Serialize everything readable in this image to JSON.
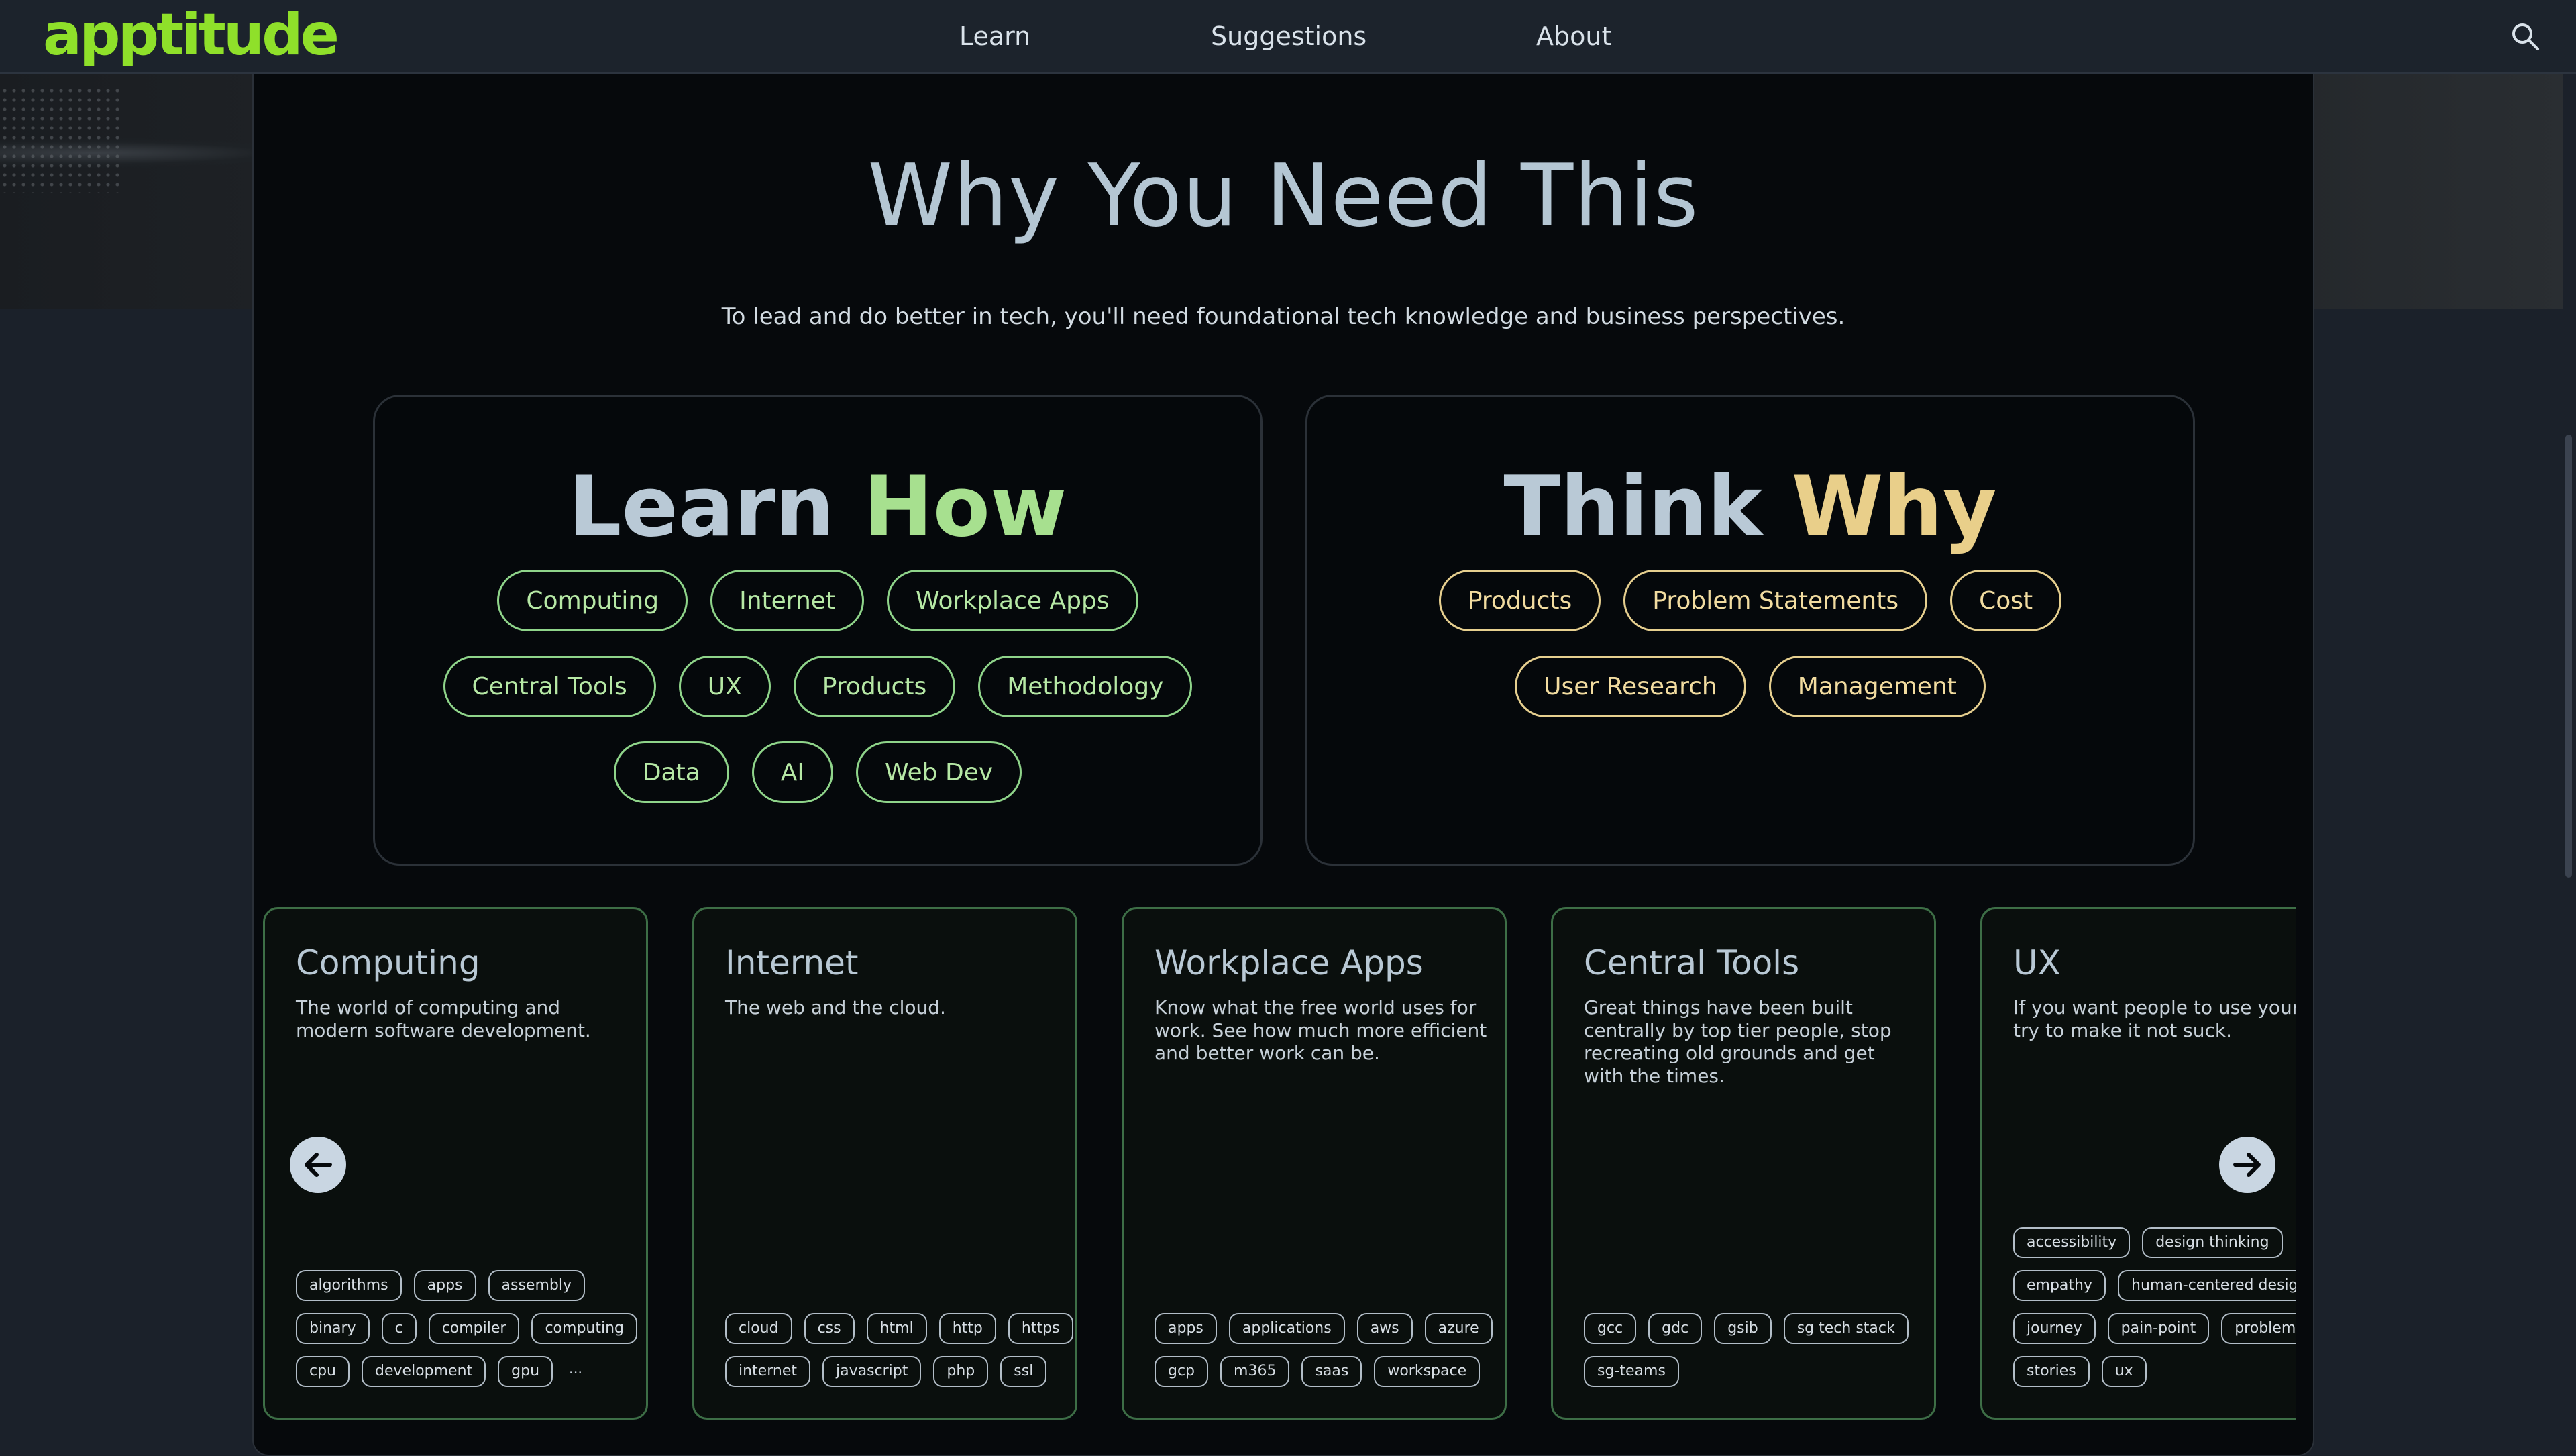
{
  "navbar": {
    "logo": "apptitude",
    "links": [
      "Learn",
      "Suggestions",
      "About"
    ],
    "search_icon": "search-icon"
  },
  "section": {
    "title": "Why You Need This",
    "subtitle": "To lead and do better in tech, you'll need foundational tech knowledge and business perspectives."
  },
  "learn_how": {
    "title_part1": "Learn",
    "title_part2": "How",
    "accent_color": "#a7e08f",
    "pills": [
      "Computing",
      "Internet",
      "Workplace Apps",
      "Central Tools",
      "UX",
      "Products",
      "Methodology",
      "Data",
      "AI",
      "Web Dev"
    ]
  },
  "think_why": {
    "title_part1": "Think",
    "title_part2": "Why",
    "accent_color": "#e9cf8a",
    "pills": [
      "Products",
      "Problem Statements",
      "Cost",
      "User Research",
      "Management"
    ]
  },
  "carousel": {
    "prev_icon": "arrow-left-icon",
    "next_icon": "arrow-right-icon",
    "cards": [
      {
        "title": "Computing",
        "description": "The world of computing and modern software development.",
        "tags": [
          "algorithms",
          "apps",
          "assembly",
          "binary",
          "c",
          "compiler",
          "computing",
          "cpu",
          "development",
          "gpu"
        ],
        "more": "..."
      },
      {
        "title": "Internet",
        "description": "The web and the cloud.",
        "tags": [
          "cloud",
          "css",
          "html",
          "http",
          "https",
          "internet",
          "javascript",
          "php",
          "ssl"
        ]
      },
      {
        "title": "Workplace Apps",
        "description": "Know what the free world uses for work. See how much more efficient and better work can be.",
        "tags": [
          "apps",
          "applications",
          "aws",
          "azure",
          "gcp",
          "m365",
          "saas",
          "workspace"
        ]
      },
      {
        "title": "Central Tools",
        "description": "Great things have been built centrally by top tier people, stop recreating old grounds and get with the times.",
        "tags": [
          "gcc",
          "gdc",
          "gsib",
          "sg tech stack",
          "sg-teams"
        ]
      },
      {
        "title": "UX",
        "description": "If you want people to use your app, try to make it not suck.",
        "tags": [
          "accessibility",
          "design thinking",
          "empathy",
          "human-centered design",
          "journey",
          "pain-point",
          "problem",
          "stories",
          "ux"
        ]
      }
    ]
  }
}
